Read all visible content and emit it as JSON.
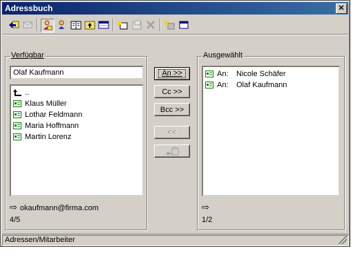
{
  "window": {
    "title": "Adressbuch",
    "close_glyph": "✕"
  },
  "toolbar": {
    "buttons": [
      {
        "icon": "back-arrow-icon"
      },
      {
        "icon": "mail-icon"
      },
      {
        "icon": "person-icon"
      },
      {
        "icon": "person-card-icon"
      },
      {
        "icon": "address-book-icon"
      },
      {
        "icon": "folder-up-icon"
      },
      {
        "icon": "list-view-icon"
      },
      {
        "icon": "new-entry-icon"
      },
      {
        "icon": "properties-icon"
      },
      {
        "icon": "delete-icon"
      },
      {
        "icon": "new-group-icon"
      },
      {
        "icon": "window-icon"
      }
    ]
  },
  "available": {
    "label": "Verfügbar",
    "search_value": "Olaf Kaufmann",
    "up_item": "..",
    "items": [
      "Klaus Müller",
      "Lothar Feldmann",
      "Maria Hoffmann",
      "Martin Lorenz"
    ],
    "email": "okaufmann@firma.com",
    "count": "4/5"
  },
  "buttons": {
    "to": "An >>",
    "cc": "Cc >>",
    "bcc": "Bcc >>",
    "remove": "<<"
  },
  "selected": {
    "label": "Ausgewählt",
    "items": [
      {
        "type": "An:",
        "name": "Nicole Schäfer"
      },
      {
        "type": "An:",
        "name": "Olaf Kaufmann"
      }
    ],
    "count": "1/2"
  },
  "status": {
    "text": "Adressen/Mitarbeiter"
  },
  "colors": {
    "titlebar_start": "#0a246a",
    "titlebar_end": "#3a6ea5",
    "face": "#d4d0c8"
  }
}
